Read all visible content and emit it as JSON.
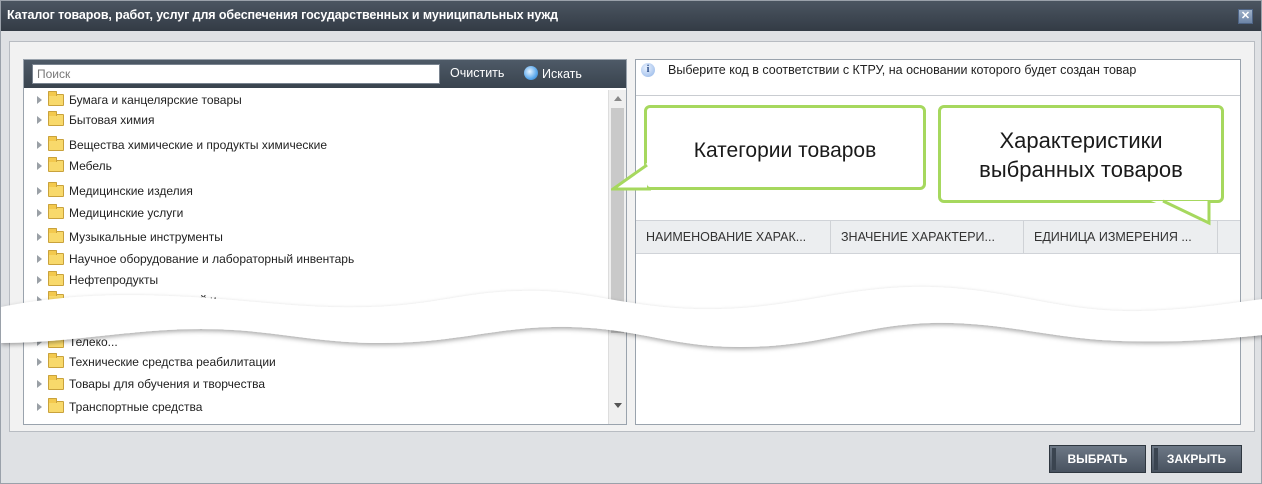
{
  "window": {
    "title": "Каталог товаров, работ, услуг для обеспечения государственных и муниципальных нужд",
    "close_glyph": "✕"
  },
  "search": {
    "placeholder": "Поиск",
    "clear_label": "Очистить",
    "search_label": "Искать"
  },
  "tree": {
    "items": [
      "Бумага и канцелярские товары",
      "Бытовая химия",
      "Вещества химические и продукты химические",
      "Мебель",
      "Медицинские изделия",
      "Медицинские услуги",
      "Музыкальные инструменты",
      "Научное оборудование и лабораторный инвентарь",
      "Нефтепродукты",
      "...я эксплуатации зданий и...",
      "Телеко...",
      "Технические средства реабилитации",
      "Товары для обучения и творчества",
      "Транспортные средства"
    ]
  },
  "info": {
    "text": "Выберите код в соответствии с КТРУ, на основании которого будет создан товар"
  },
  "grid": {
    "columns": [
      "НАИМЕНОВАНИЕ ХАРАК...",
      "ЗНАЧЕНИЕ ХАРАКТЕРИ...",
      "ЕДИНИЦА ИЗМЕРЕНИЯ ..."
    ]
  },
  "callouts": {
    "categories": "Категории товаров",
    "characteristics_line1": "Характеристики",
    "characteristics_line2": "выбранных товаров"
  },
  "buttons": {
    "select": "ВЫБРАТЬ",
    "close": "ЗАКРЫТЬ"
  },
  "colors": {
    "callout_border": "#a6d85e",
    "titlebar": "#3d4651"
  }
}
